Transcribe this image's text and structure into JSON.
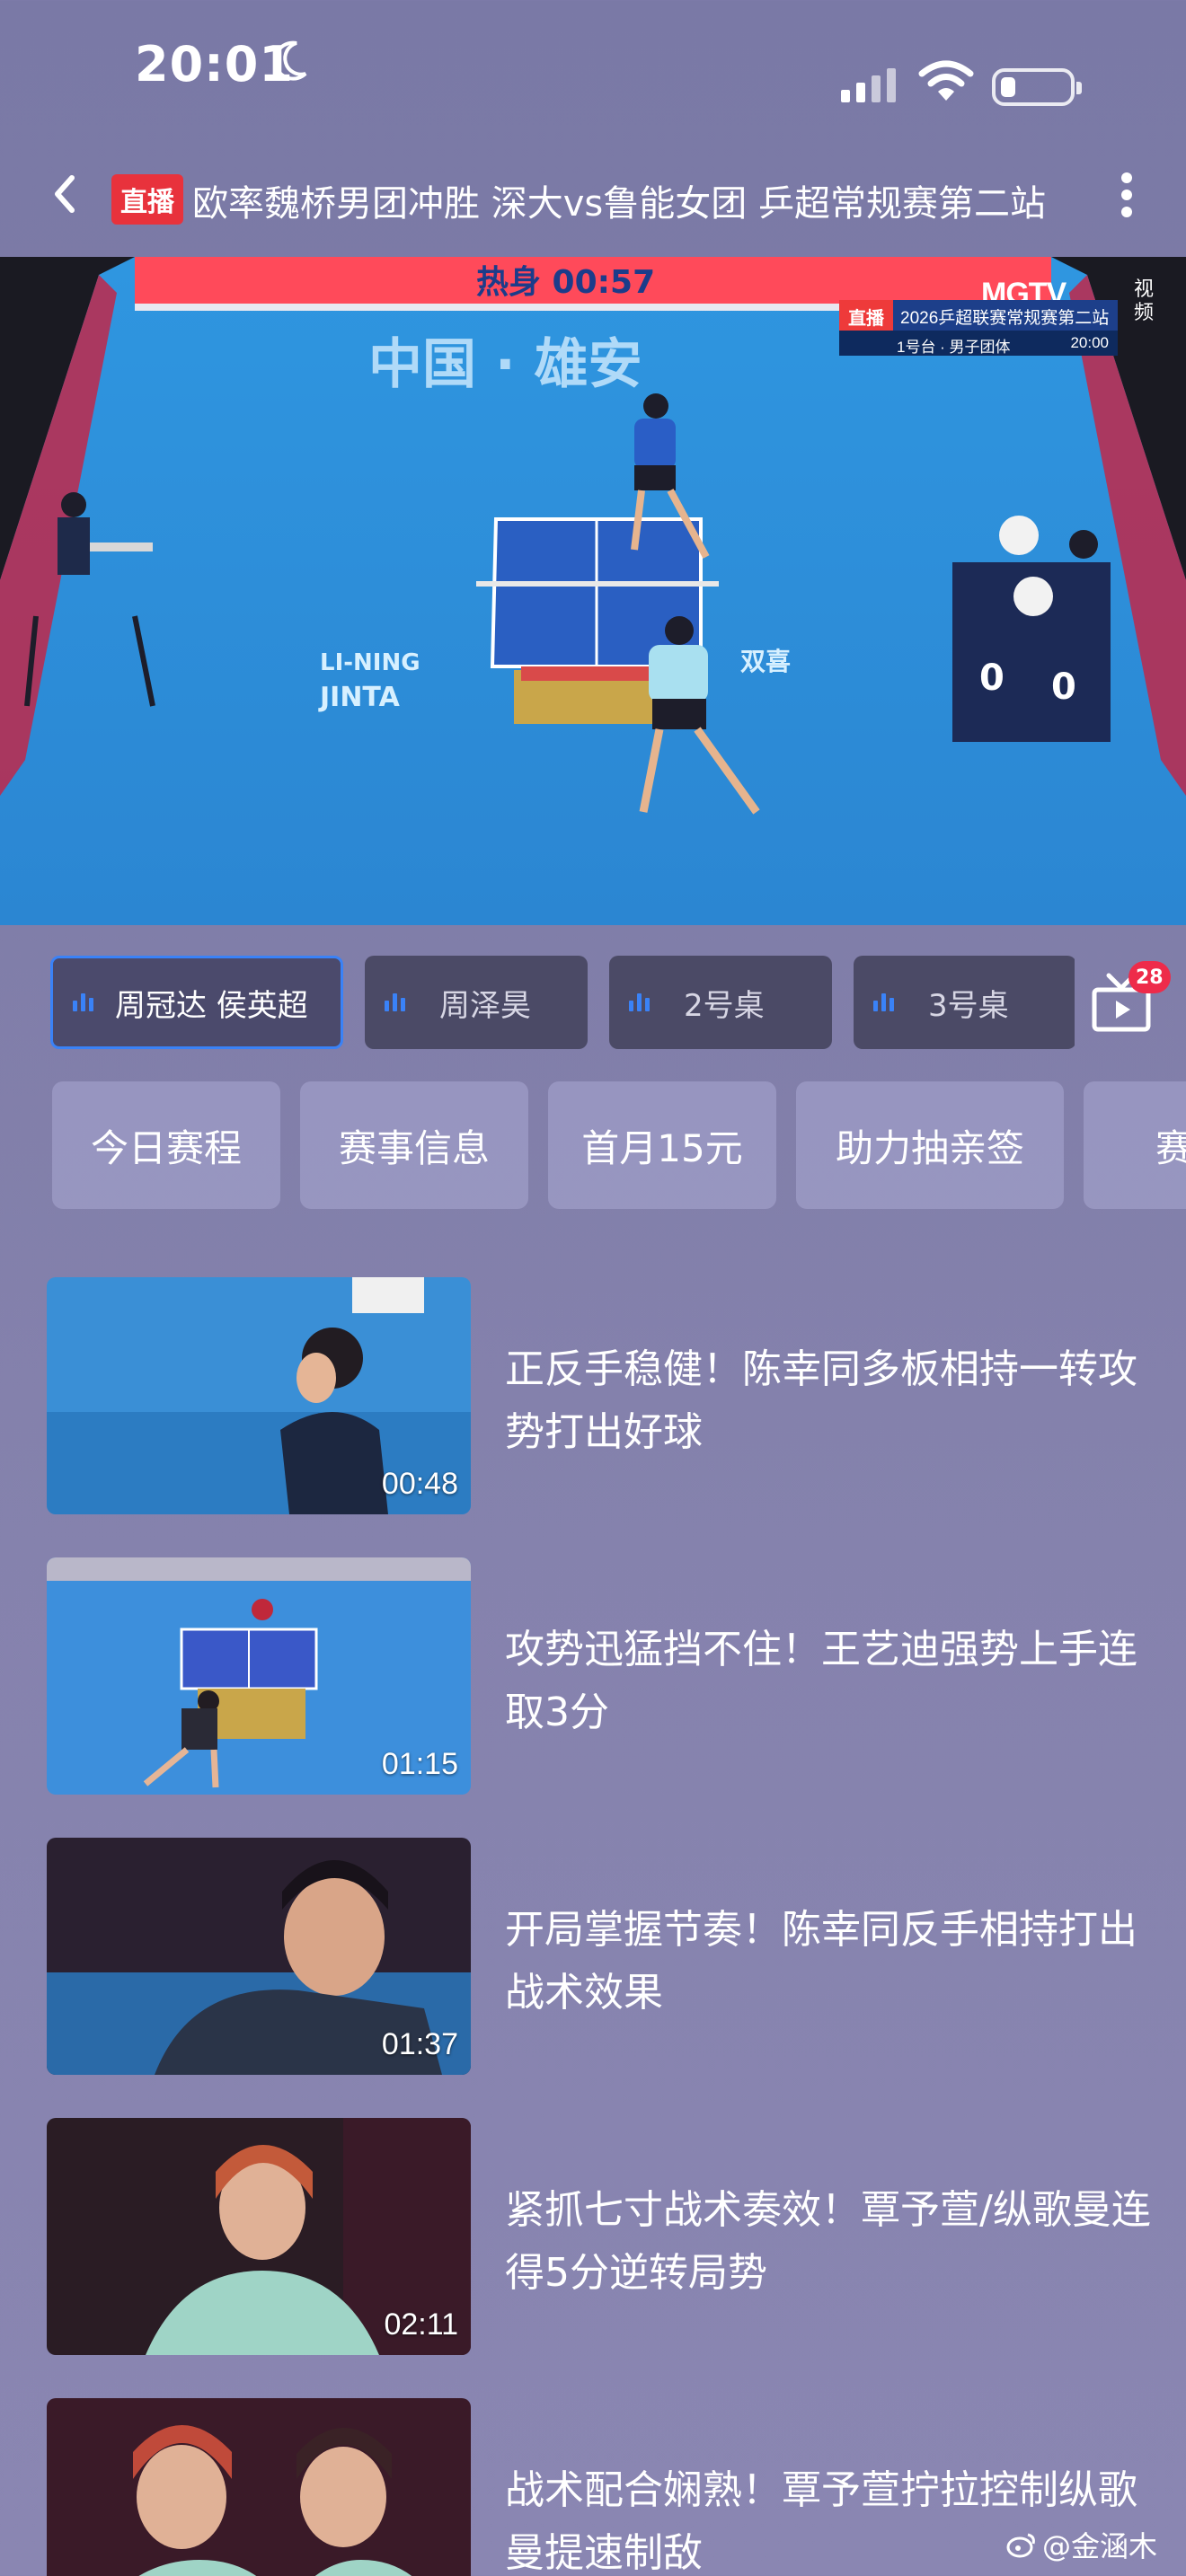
{
  "status_bar": {
    "time": "20:01",
    "icons": [
      "moon-icon",
      "cellular-signal-icon",
      "wifi-icon",
      "battery-icon"
    ]
  },
  "header": {
    "live_badge": "直播",
    "title": "欧率魏桥男团冲胜 深大vs鲁能女团     乒超常规赛第二站"
  },
  "video": {
    "overlay_live": "直播",
    "overlay_title": "2026乒超联赛常规赛第二站",
    "overlay_table": "1号台 · 男子团体",
    "overlay_time": "20:00",
    "brand": "MGTV",
    "brand_sub": "视频"
  },
  "camera_chips": [
    {
      "label": "周冠达 侯英超",
      "active": true
    },
    {
      "label": "周泽昊",
      "active": false
    },
    {
      "label": "2号桌",
      "active": false
    },
    {
      "label": "3号桌",
      "active": false
    }
  ],
  "tv_badge_count": "28",
  "tag_pills": [
    "今日赛程",
    "赛事信息",
    "首月15元",
    "助力抽亲签",
    "赛"
  ],
  "videos": [
    {
      "title": "正反手稳健！陈幸同多板相持一转攻势打出好球",
      "duration": "00:48"
    },
    {
      "title": "攻势迅猛挡不住！王艺迪强势上手连取3分",
      "duration": "01:15"
    },
    {
      "title": "开局掌握节奏！陈幸同反手相持打出战术效果",
      "duration": "01:37"
    },
    {
      "title": "紧抓七寸战术奏效！覃予萱/纵歌曼连得5分逆转局势",
      "duration": "02:11"
    },
    {
      "title": "战术配合娴熟！覃予萱拧拉控制纵歌曼提速制敌",
      "duration": ""
    }
  ],
  "watermark": "@金涵木",
  "colors": {
    "background": "#7d7ba6",
    "accent_blue": "#3a82f7",
    "live_red": "#e8323c",
    "badge_red": "#ee2b4a"
  }
}
